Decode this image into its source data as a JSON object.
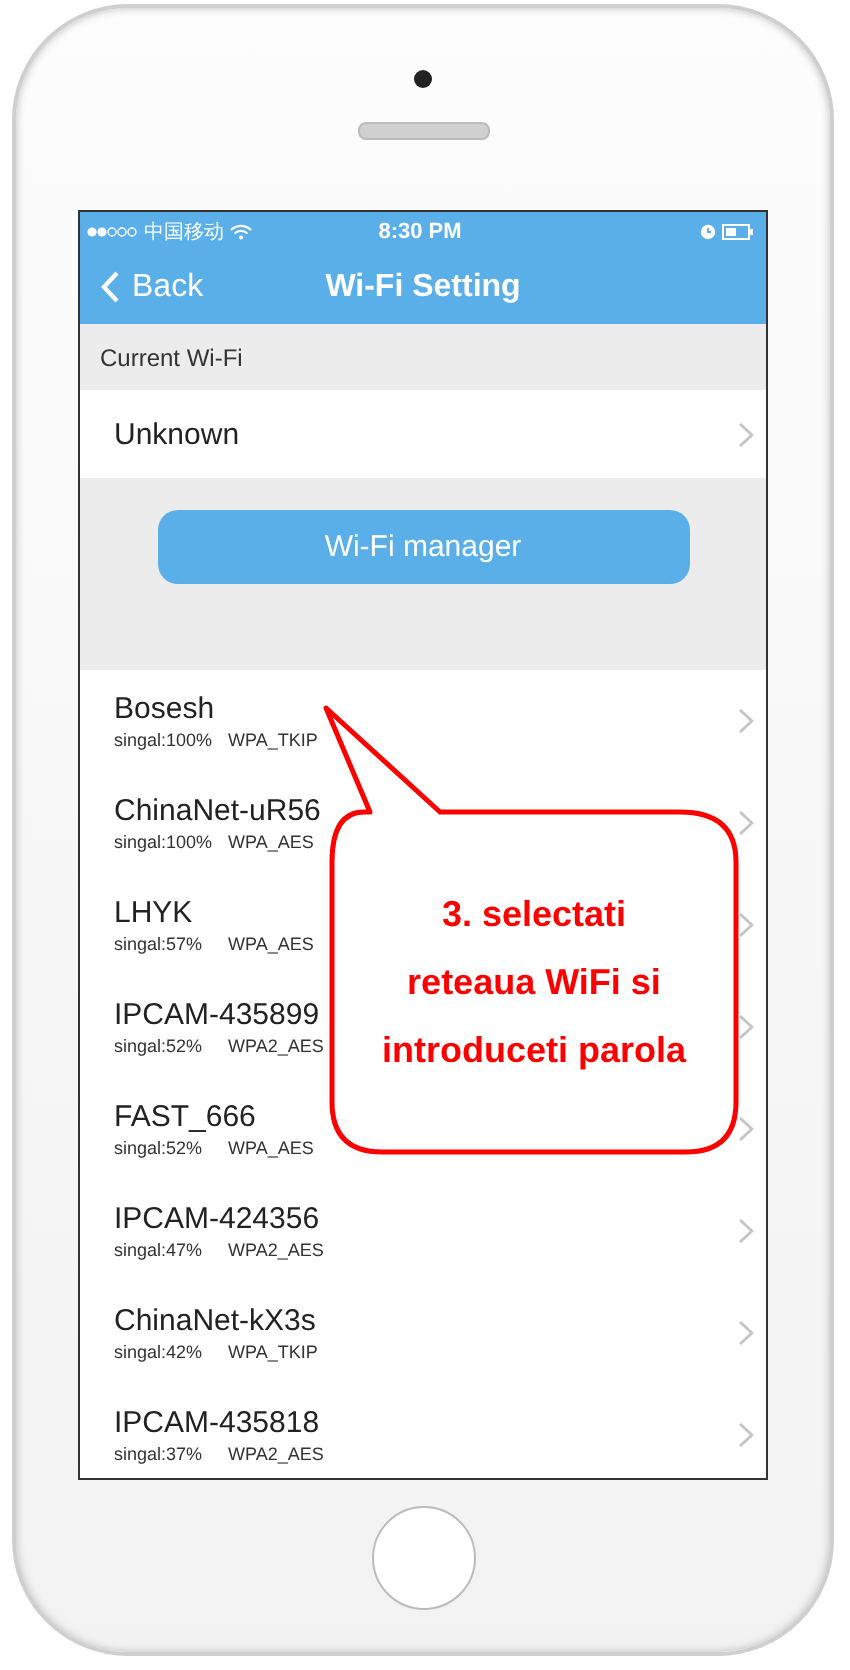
{
  "status_bar": {
    "carrier": "中国移动",
    "time": "8:30 PM"
  },
  "nav": {
    "back": "Back",
    "title": "Wi-Fi Setting"
  },
  "current": {
    "header": "Current Wi-Fi",
    "network": "Unknown"
  },
  "manager_button": "Wi-Fi manager",
  "networks": [
    {
      "name": "Bosesh",
      "signal": "singal:100%",
      "security": "WPA_TKIP"
    },
    {
      "name": "ChinaNet-uR56",
      "signal": "singal:100%",
      "security": "WPA_AES"
    },
    {
      "name": "LHYK",
      "signal": "singal:57%",
      "security": "WPA_AES"
    },
    {
      "name": "IPCAM-435899",
      "signal": "singal:52%",
      "security": "WPA2_AES"
    },
    {
      "name": "FAST_666",
      "signal": "singal:52%",
      "security": "WPA_AES"
    },
    {
      "name": "IPCAM-424356",
      "signal": "singal:47%",
      "security": "WPA2_AES"
    },
    {
      "name": "ChinaNet-kX3s",
      "signal": "singal:42%",
      "security": "WPA_TKIP"
    },
    {
      "name": "IPCAM-435818",
      "signal": "singal:37%",
      "security": "WPA2_AES"
    }
  ],
  "callout": {
    "lines": [
      "3. selectati",
      "reteaua WiFi si",
      "introduceti parola"
    ]
  }
}
